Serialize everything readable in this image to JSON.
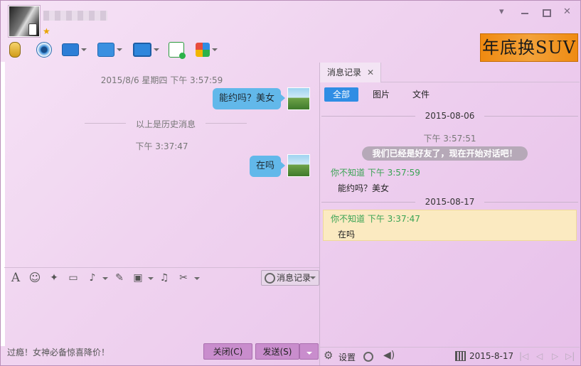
{
  "header": {
    "star_glyph": "★",
    "window_controls": {
      "menu": "▾",
      "minimize": "",
      "maximize": "",
      "close": "✕"
    }
  },
  "ad_banner": {
    "text": "年底换SUV"
  },
  "toolbar": {
    "icons": [
      "microphone-icon",
      "webcam-icon",
      "screen-share-icon",
      "send-file-icon",
      "remote-desktop-icon",
      "group-chat-icon",
      "apps-icon"
    ]
  },
  "chat": {
    "timestamp1": "2015/8/6 星期四 下午 3:57:59",
    "message1": "能约吗？美女",
    "history_divider": "以上是历史消息",
    "timestamp2": "下午 3:37:47",
    "message2": "在吗"
  },
  "input_toolbar": {
    "icons": {
      "font": "A",
      "emoji": "☺",
      "shake": "✦",
      "screenshot": "▭",
      "voice": "♪",
      "edit": "✎",
      "image": "▣",
      "music": "♫",
      "scissors": "✂"
    },
    "history_button": "消息记录"
  },
  "footer": {
    "promo": "过瘾！女神必备惊喜降价！",
    "close_button": "关闭(C)",
    "send_button": "发送(S)"
  },
  "history": {
    "tab_label": "消息记录",
    "tab_close": "✕",
    "filters": [
      "全部",
      "图片",
      "文件"
    ],
    "date1": "2015-08-06",
    "time1": "下午 3:57:51",
    "system_message": "我们已经是好友了，现在开始对话吧！",
    "sender1": "你不知道 下午 3:57:59",
    "message1": "能约吗？美女",
    "date2": "2015-08-17",
    "sender2": "你不知道 下午 3:37:47",
    "message2": "在吗"
  },
  "history_footer": {
    "settings_label": "设置",
    "date": "2015-8-17",
    "nav": [
      "|◁",
      "◁",
      "▷",
      "▷|"
    ]
  },
  "colors": {
    "accent_blue": "#2f8de4",
    "bubble": "#62b8ea",
    "sender_green": "#3aa354",
    "button": "#c98dcd"
  }
}
